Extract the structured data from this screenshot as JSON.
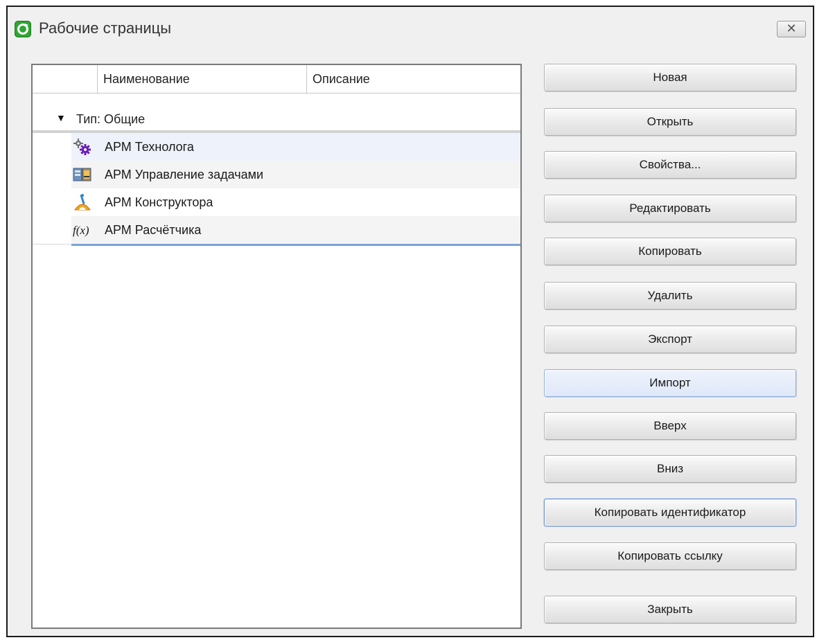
{
  "window": {
    "title": "Рабочие страницы",
    "close_label": "✕"
  },
  "list": {
    "columns": [
      "",
      "Наименование",
      "Описание"
    ],
    "group_label": "Тип: Общие",
    "items": [
      {
        "label": "АРМ Технолога",
        "icon": "gears-icon",
        "selected": true
      },
      {
        "label": "АРМ Управление задачами",
        "icon": "task-manager-icon"
      },
      {
        "label": "АРМ Конструктора",
        "icon": "drafting-compass-icon"
      },
      {
        "label": "АРМ Расчётчика",
        "icon": "function-fx-icon"
      }
    ]
  },
  "buttons": {
    "new": "Новая",
    "open": "Открыть",
    "properties": "Свойства...",
    "edit": "Редактировать",
    "copy": "Копировать",
    "delete": "Удалить",
    "export": "Экспорт",
    "import": "Импорт",
    "up": "Вверх",
    "down": "Вниз",
    "copy_id": "Копировать идентификатор",
    "copy_link": "Копировать ссылку",
    "close": "Закрыть"
  },
  "colors": {
    "accent": "#7aa2d6",
    "selection": "#eef2fb",
    "app_icon": "#2fa532"
  }
}
